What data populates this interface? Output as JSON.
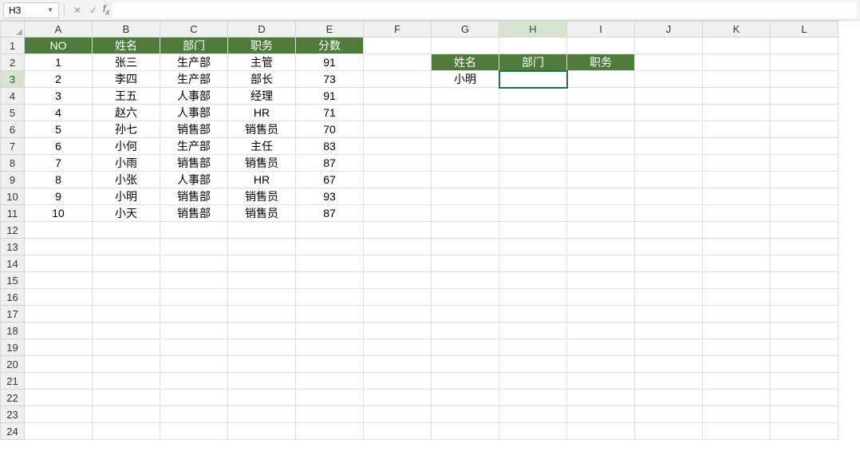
{
  "formula_bar": {
    "name_box": "H3",
    "formula": ""
  },
  "active_cell": {
    "col": "H",
    "row": 3
  },
  "columns": [
    "A",
    "B",
    "C",
    "D",
    "E",
    "F",
    "G",
    "H",
    "I",
    "J",
    "K",
    "L"
  ],
  "col_widths": {
    "A": 85,
    "B": 85,
    "C": 85,
    "D": 85,
    "E": 85,
    "F": 85,
    "G": 85,
    "H": 85,
    "I": 85,
    "J": 85,
    "K": 85,
    "L": 85
  },
  "row_count": 24,
  "header_fill": "#4e7a3a",
  "cells": {
    "A1": {
      "v": "NO",
      "hdr": true
    },
    "B1": {
      "v": "姓名",
      "hdr": true
    },
    "C1": {
      "v": "部门",
      "hdr": true
    },
    "D1": {
      "v": "职务",
      "hdr": true
    },
    "E1": {
      "v": "分数",
      "hdr": true
    },
    "A2": {
      "v": "1"
    },
    "B2": {
      "v": "张三"
    },
    "C2": {
      "v": "生产部"
    },
    "D2": {
      "v": "主管"
    },
    "E2": {
      "v": "91"
    },
    "A3": {
      "v": "2"
    },
    "B3": {
      "v": "李四"
    },
    "C3": {
      "v": "生产部"
    },
    "D3": {
      "v": "部长"
    },
    "E3": {
      "v": "73"
    },
    "A4": {
      "v": "3"
    },
    "B4": {
      "v": "王五"
    },
    "C4": {
      "v": "人事部"
    },
    "D4": {
      "v": "经理"
    },
    "E4": {
      "v": "91"
    },
    "A5": {
      "v": "4"
    },
    "B5": {
      "v": "赵六"
    },
    "C5": {
      "v": "人事部"
    },
    "D5": {
      "v": "HR"
    },
    "E5": {
      "v": "71"
    },
    "A6": {
      "v": "5"
    },
    "B6": {
      "v": "孙七"
    },
    "C6": {
      "v": "销售部"
    },
    "D6": {
      "v": "销售员"
    },
    "E6": {
      "v": "70"
    },
    "A7": {
      "v": "6"
    },
    "B7": {
      "v": "小何"
    },
    "C7": {
      "v": "生产部"
    },
    "D7": {
      "v": "主任"
    },
    "E7": {
      "v": "83"
    },
    "A8": {
      "v": "7"
    },
    "B8": {
      "v": "小雨"
    },
    "C8": {
      "v": "销售部"
    },
    "D8": {
      "v": "销售员"
    },
    "E8": {
      "v": "87"
    },
    "A9": {
      "v": "8"
    },
    "B9": {
      "v": "小张"
    },
    "C9": {
      "v": "人事部"
    },
    "D9": {
      "v": "HR"
    },
    "E9": {
      "v": "67"
    },
    "A10": {
      "v": "9"
    },
    "B10": {
      "v": "小明"
    },
    "C10": {
      "v": "销售部"
    },
    "D10": {
      "v": "销售员"
    },
    "E10": {
      "v": "93"
    },
    "A11": {
      "v": "10"
    },
    "B11": {
      "v": "小天"
    },
    "C11": {
      "v": "销售部"
    },
    "D11": {
      "v": "销售员"
    },
    "E11": {
      "v": "87"
    },
    "G2": {
      "v": "姓名",
      "hdr": true
    },
    "H2": {
      "v": "部门",
      "hdr": true
    },
    "I2": {
      "v": "职务",
      "hdr": true
    },
    "G3": {
      "v": "小明"
    }
  },
  "chart_data": {
    "type": "table",
    "columns": [
      "NO",
      "姓名",
      "部门",
      "职务",
      "分数"
    ],
    "rows": [
      [
        1,
        "张三",
        "生产部",
        "主管",
        91
      ],
      [
        2,
        "李四",
        "生产部",
        "部长",
        73
      ],
      [
        3,
        "王五",
        "人事部",
        "经理",
        91
      ],
      [
        4,
        "赵六",
        "人事部",
        "HR",
        71
      ],
      [
        5,
        "孙七",
        "销售部",
        "销售员",
        70
      ],
      [
        6,
        "小何",
        "生产部",
        "主任",
        83
      ],
      [
        7,
        "小雨",
        "销售部",
        "销售员",
        87
      ],
      [
        8,
        "小张",
        "人事部",
        "HR",
        67
      ],
      [
        9,
        "小明",
        "销售部",
        "销售员",
        93
      ],
      [
        10,
        "小天",
        "销售部",
        "销售员",
        87
      ]
    ],
    "lookup_panel": {
      "headers": [
        "姓名",
        "部门",
        "职务"
      ],
      "query": {
        "姓名": "小明"
      }
    }
  }
}
